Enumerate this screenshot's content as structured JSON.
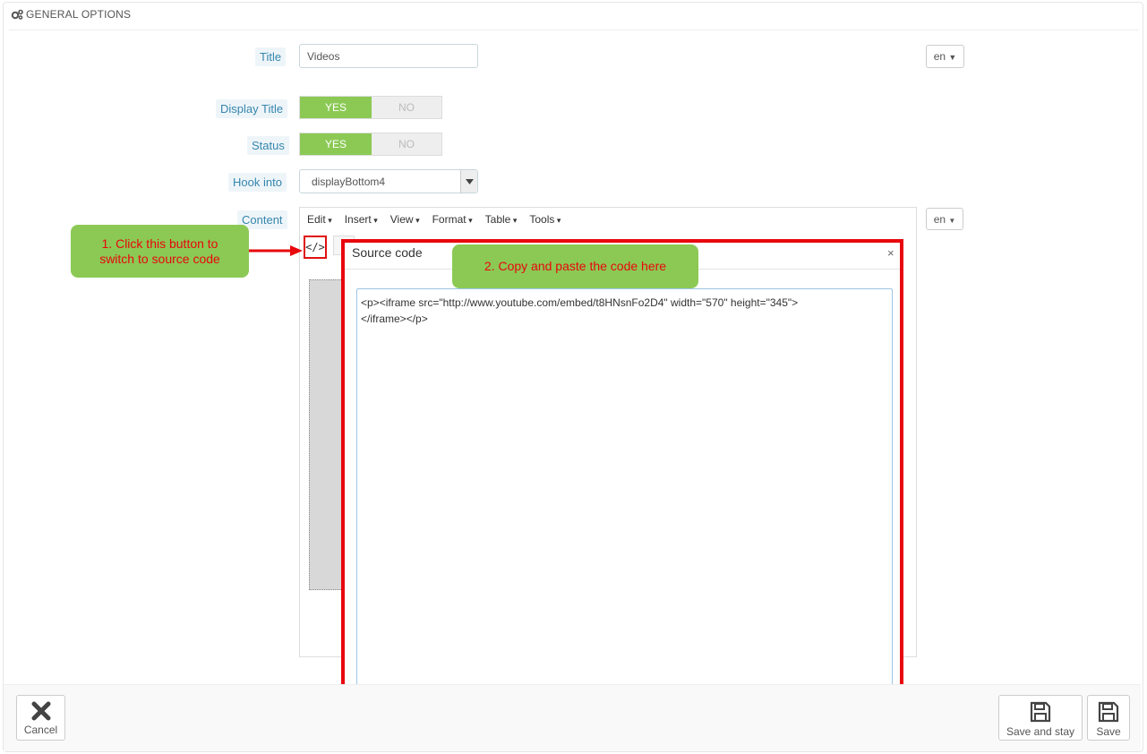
{
  "panel": {
    "heading": "GENERAL OPTIONS"
  },
  "form": {
    "title": {
      "label": "Title",
      "value": "Videos",
      "lang": "en"
    },
    "display_title": {
      "label": "Display Title",
      "yes": "YES",
      "no": "NO"
    },
    "status": {
      "label": "Status",
      "yes": "YES",
      "no": "NO"
    },
    "hook_into": {
      "label": "Hook into",
      "value": "displayBottom4"
    },
    "content": {
      "label": "Content",
      "lang": "en"
    }
  },
  "editor": {
    "menu": [
      "Edit",
      "Insert",
      "View",
      "Format",
      "Table",
      "Tools"
    ],
    "source_code_button": "</>"
  },
  "modal": {
    "title": "Source code",
    "close": "×",
    "code": "<p><iframe src=\"http://www.youtube.com/embed/t8HNsnFo2D4\" width=\"570\" height=\"345\">\n</iframe></p>"
  },
  "callouts": {
    "step1": "1. Click this button to switch to source code",
    "step2": "2. Copy and paste the code here"
  },
  "footer": {
    "cancel": "Cancel",
    "save_and_stay": "Save and stay",
    "save": "Save"
  },
  "colors": {
    "accent_green": "#8bc954",
    "annotation_red": "#e8070d",
    "label_blue": "#3586ae"
  }
}
